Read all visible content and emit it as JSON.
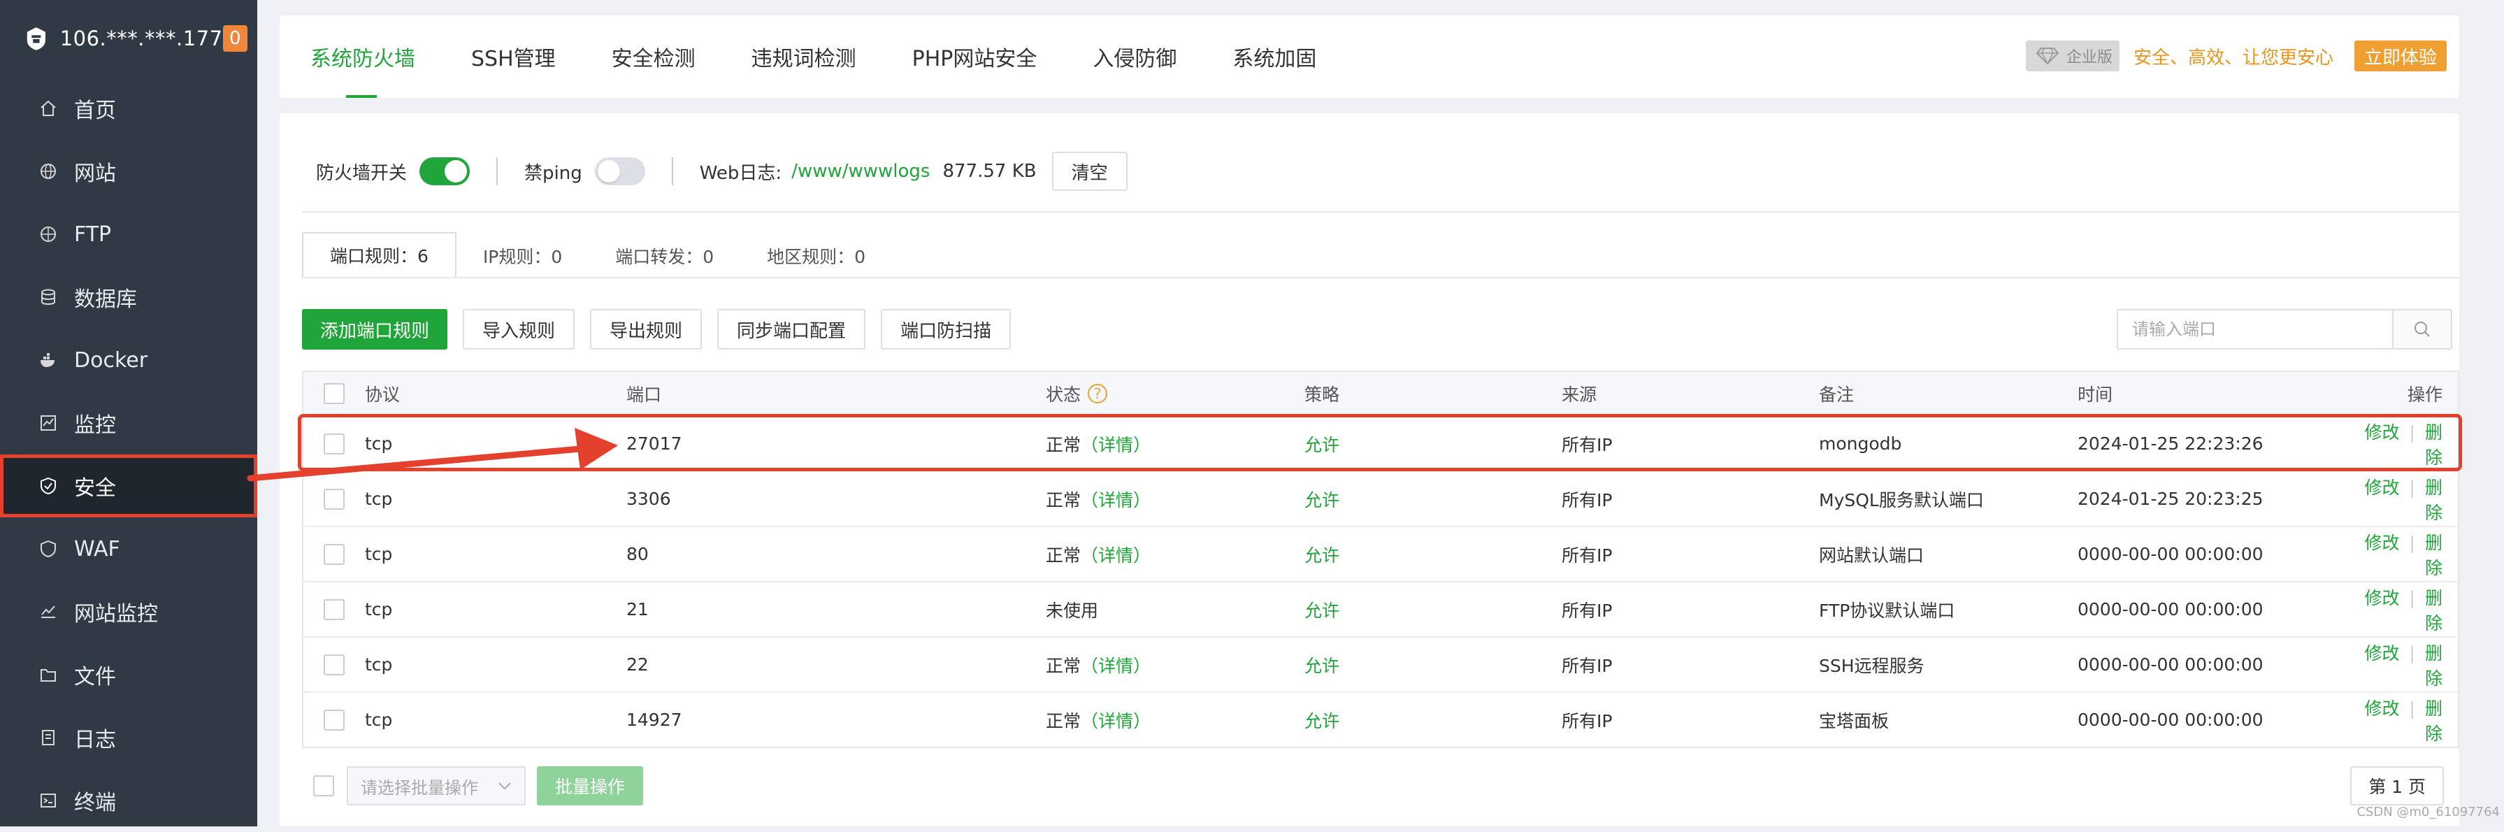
{
  "sidebar": {
    "ip": "106.***.***.177",
    "badge": "0",
    "items": [
      {
        "label": "首页",
        "icon": "home-icon"
      },
      {
        "label": "网站",
        "icon": "globe-icon"
      },
      {
        "label": "FTP",
        "icon": "ftp-icon"
      },
      {
        "label": "数据库",
        "icon": "database-icon"
      },
      {
        "label": "Docker",
        "icon": "docker-icon"
      },
      {
        "label": "监控",
        "icon": "monitor-icon"
      },
      {
        "label": "安全",
        "icon": "shield-icon"
      },
      {
        "label": "WAF",
        "icon": "waf-shield-icon"
      },
      {
        "label": "网站监控",
        "icon": "chart-line-icon"
      },
      {
        "label": "文件",
        "icon": "folder-icon"
      },
      {
        "label": "日志",
        "icon": "log-icon"
      },
      {
        "label": "终端",
        "icon": "terminal-icon"
      }
    ],
    "active_index": 6
  },
  "topnav": {
    "tabs": [
      "系统防火墙",
      "SSH管理",
      "安全检测",
      "违规词检测",
      "PHP网站安全",
      "入侵防御",
      "系统加固"
    ],
    "active_index": 0,
    "enterprise_label": "企业版",
    "promo_text": "安全、高效、让您更安心",
    "try_label": "立即体验"
  },
  "firewall": {
    "switch_label": "防火墙开关",
    "switch_on": true,
    "ping_label": "禁ping",
    "ping_on": false,
    "weblog_label": "Web日志:",
    "weblog_path": "/www/wwwlogs",
    "weblog_size": "877.57 KB",
    "clear_label": "清空"
  },
  "subtabs": [
    "端口规则：6",
    "IP规则：0",
    "端口转发：0",
    "地区规则：0"
  ],
  "toolbar": {
    "add": "添加端口规则",
    "import": "导入规则",
    "export": "导出规则",
    "sync": "同步端口配置",
    "scan": "端口防扫描",
    "search_placeholder": "请输入端口"
  },
  "table": {
    "headers": {
      "protocol": "协议",
      "port": "端口",
      "status": "状态",
      "policy": "策略",
      "source": "来源",
      "note": "备注",
      "time": "时间",
      "ops": "操作"
    },
    "rows": [
      {
        "protocol": "tcp",
        "port": "27017",
        "status": "正常",
        "detail": "（详情）",
        "policy": "允许",
        "source": "所有IP",
        "note": "mongodb",
        "time": "2024-01-25 22:23:26"
      },
      {
        "protocol": "tcp",
        "port": "3306",
        "status": "正常",
        "detail": "（详情）",
        "policy": "允许",
        "source": "所有IP",
        "note": "MySQL服务默认端口",
        "time": "2024-01-25 20:23:25"
      },
      {
        "protocol": "tcp",
        "port": "80",
        "status": "正常",
        "detail": "（详情）",
        "policy": "允许",
        "source": "所有IP",
        "note": "网站默认端口",
        "time": "0000-00-00 00:00:00"
      },
      {
        "protocol": "tcp",
        "port": "21",
        "status": "未使用",
        "detail": "",
        "policy": "允许",
        "source": "所有IP",
        "note": "FTP协议默认端口",
        "time": "0000-00-00 00:00:00"
      },
      {
        "protocol": "tcp",
        "port": "22",
        "status": "正常",
        "detail": "（详情）",
        "policy": "允许",
        "source": "所有IP",
        "note": "SSH远程服务",
        "time": "0000-00-00 00:00:00"
      },
      {
        "protocol": "tcp",
        "port": "14927",
        "status": "正常",
        "detail": "（详情）",
        "policy": "允许",
        "source": "所有IP",
        "note": "宝塔面板",
        "time": "0000-00-00 00:00:00"
      }
    ],
    "op_edit": "修改",
    "op_delete": "删除"
  },
  "bottom": {
    "batch_placeholder": "请选择批量操作",
    "batch_button": "批量操作",
    "page": "第 1 页"
  },
  "watermark": "CSDN @m0_61097764",
  "colors": {
    "accent": "#20a53a",
    "annotation": "#e3402d",
    "warning": "#f0a032"
  }
}
